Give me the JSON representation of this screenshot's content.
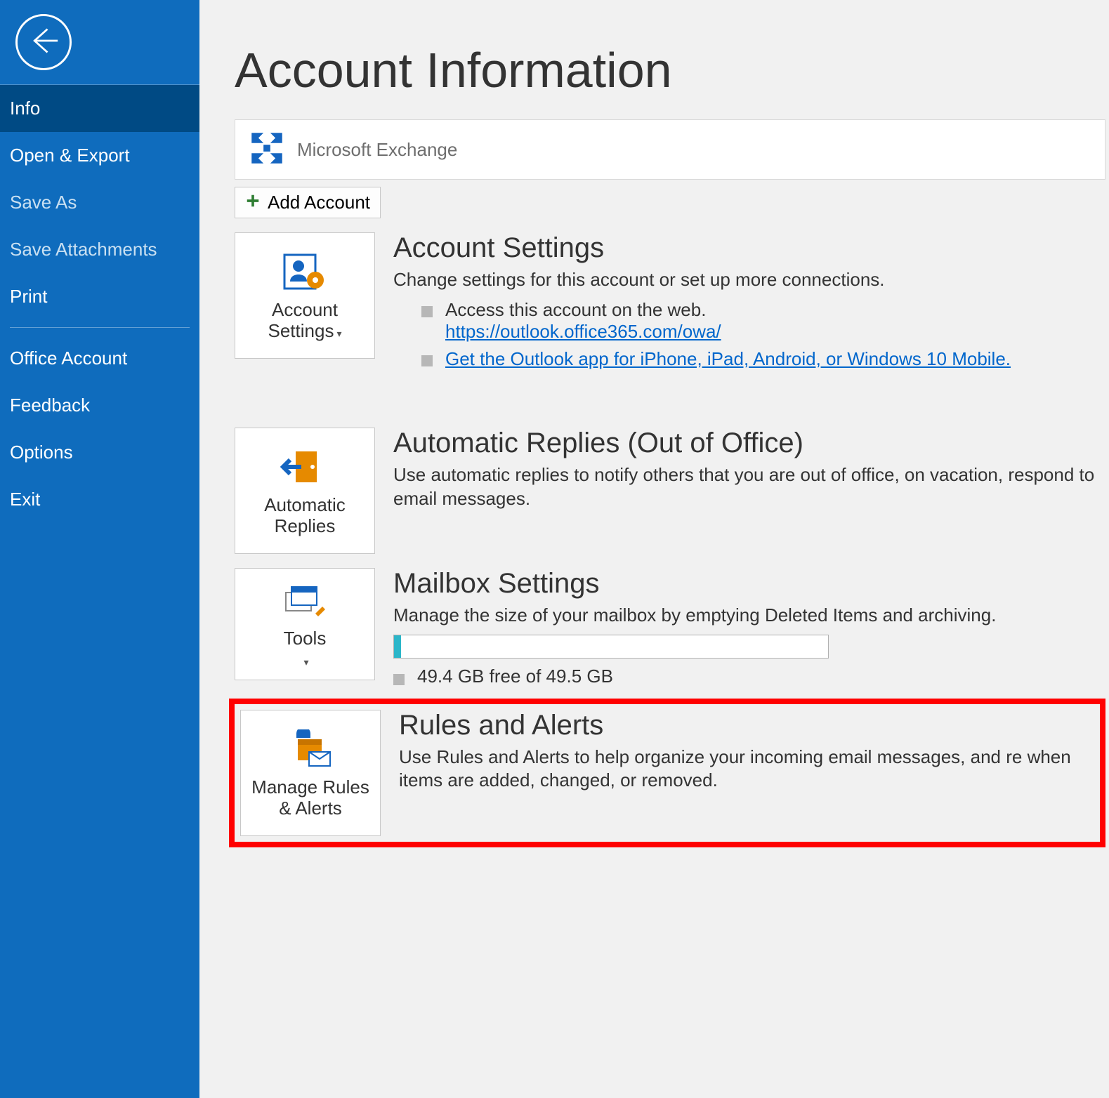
{
  "sidebar": {
    "items": [
      {
        "label": "Info",
        "active": true
      },
      {
        "label": "Open & Export"
      },
      {
        "label": "Save As",
        "dim": true
      },
      {
        "label": "Save Attachments",
        "dim": true
      },
      {
        "label": "Print"
      },
      {
        "label": "Office Account"
      },
      {
        "label": "Feedback"
      },
      {
        "label": "Options"
      },
      {
        "label": "Exit"
      }
    ]
  },
  "page": {
    "title": "Account Information"
  },
  "account": {
    "type": "Microsoft Exchange",
    "add_label": "Add Account"
  },
  "settings": {
    "btn_label": "Account Settings",
    "title": "Account Settings",
    "desc": "Change settings for this account or set up more connections.",
    "bullet1": "Access this account on the web.",
    "owa_link": "https://outlook.office365.com/owa/",
    "app_link": "Get the Outlook app for iPhone, iPad, Android, or Windows 10 Mobile."
  },
  "autoreply": {
    "btn_label": "Automatic Replies",
    "title": "Automatic Replies (Out of Office)",
    "desc": "Use automatic replies to notify others that you are out of office, on vacation, respond to email messages."
  },
  "mailbox": {
    "btn_label": "Tools",
    "title": "Mailbox Settings",
    "desc": "Manage the size of your mailbox by emptying Deleted Items and archiving.",
    "free_text": "49.4 GB free of 49.5 GB"
  },
  "rules": {
    "btn_label": "Manage Rules & Alerts",
    "title": "Rules and Alerts",
    "desc": "Use Rules and Alerts to help organize your incoming email messages, and re when items are added, changed, or removed."
  }
}
